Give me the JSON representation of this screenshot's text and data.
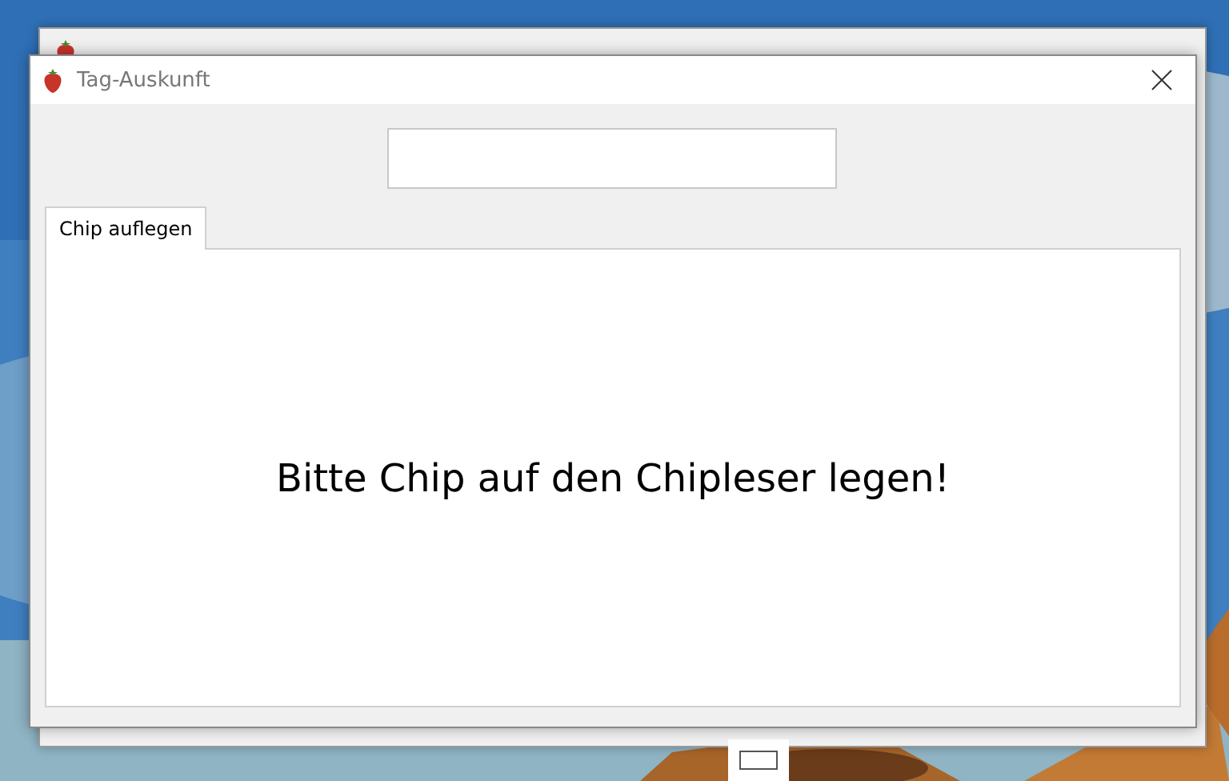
{
  "dialog": {
    "title": "Tag-Auskunft",
    "tabs": [
      {
        "label": "Chip auflegen",
        "selected": true
      }
    ],
    "message": "Bitte Chip auf den Chipleser legen!"
  }
}
